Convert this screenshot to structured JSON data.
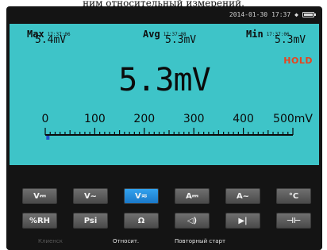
{
  "caption": "ним относительный измерений.",
  "status": {
    "date": "2014-01-30",
    "time": "17:37"
  },
  "stats": {
    "max": {
      "label": "Max",
      "time": "17:37:06",
      "value": "5.4mV"
    },
    "avg": {
      "label": "Avg",
      "time": "17:37:08",
      "value": "5.3mV"
    },
    "min": {
      "label": "Min",
      "time": "17:37:06",
      "value": "5.3mV"
    }
  },
  "hold": "HOLD",
  "reading": "5.3mV",
  "scale": {
    "labels": [
      "0",
      "100",
      "200",
      "300",
      "400",
      "500mV"
    ],
    "max": 500,
    "pointer": 5.3
  },
  "buttons": [
    {
      "label": "V⎓",
      "icon": "dc-voltage-icon",
      "active": false
    },
    {
      "label": "V~",
      "icon": "ac-voltage-icon",
      "active": false
    },
    {
      "label": "V≂",
      "icon": "ac-dc-voltage-icon",
      "active": true
    },
    {
      "label": "A⎓",
      "icon": "dc-current-icon",
      "active": false
    },
    {
      "label": "A~",
      "icon": "ac-current-icon",
      "active": false
    },
    {
      "label": "°C",
      "icon": "temperature-icon",
      "active": false
    },
    {
      "label": "%RH",
      "icon": "humidity-icon",
      "active": false
    },
    {
      "label": "Psi",
      "icon": "pressure-icon",
      "active": false
    },
    {
      "label": "Ω",
      "icon": "resistance-icon",
      "active": false
    },
    {
      "label": "◁)",
      "icon": "continuity-icon",
      "active": false
    },
    {
      "label": "▶|",
      "icon": "diode-icon",
      "active": false
    },
    {
      "label": "⊣⊢",
      "icon": "capacitance-icon",
      "active": false
    }
  ],
  "softkeys": [
    {
      "label": "Клиенск",
      "enabled": false
    },
    {
      "label": "Относит.",
      "enabled": true
    },
    {
      "label": "Повторный старт",
      "enabled": true
    }
  ],
  "colors": {
    "screen": "#3ec4c8",
    "hold": "#e8441e",
    "active_button": "#1f88d8",
    "pointer": "#2255cc"
  }
}
